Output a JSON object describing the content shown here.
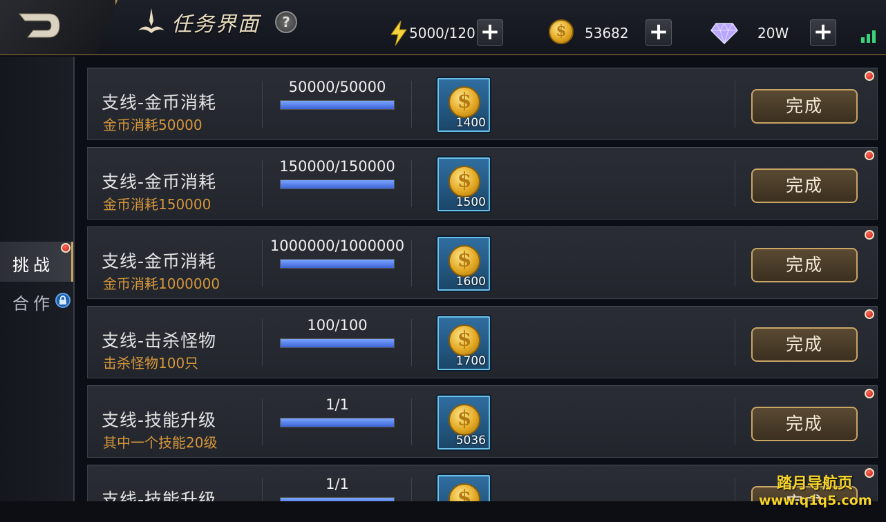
{
  "header": {
    "title": "任务界面",
    "help_label": "?",
    "energy": {
      "icon": "lightning-icon",
      "value": "5000/120"
    },
    "gold": {
      "icon": "gold-coin-icon",
      "value": "53682"
    },
    "diamond": {
      "icon": "diamond-icon",
      "value": "20W"
    },
    "plus_label": "+"
  },
  "sidebar": {
    "tabs": [
      {
        "label": "挑战",
        "active": true,
        "badge": "red-dot"
      },
      {
        "label": "合作",
        "locked": true,
        "icon": "lock-icon"
      }
    ]
  },
  "tasks": [
    {
      "name": "支线-金币消耗",
      "desc": "金币消耗50000",
      "progress_text": "50000/50000",
      "progress": 1.0,
      "reward_qty": "1400",
      "button_label": "完成"
    },
    {
      "name": "支线-金币消耗",
      "desc": "金币消耗150000",
      "progress_text": "150000/150000",
      "progress": 1.0,
      "reward_qty": "1500",
      "button_label": "完成"
    },
    {
      "name": "支线-金币消耗",
      "desc": "金币消耗1000000",
      "progress_text": "1000000/1000000",
      "progress": 1.0,
      "reward_qty": "1600",
      "button_label": "完成"
    },
    {
      "name": "支线-击杀怪物",
      "desc": "击杀怪物100只",
      "progress_text": "100/100",
      "progress": 1.0,
      "reward_qty": "1700",
      "button_label": "完成"
    },
    {
      "name": "支线-技能升级",
      "desc": "其中一个技能20级",
      "progress_text": "1/1",
      "progress": 1.0,
      "reward_qty": "5036",
      "button_label": "完成"
    },
    {
      "name": "支线-技能升级",
      "desc": "",
      "progress_text": "1/1",
      "progress": 1.0,
      "reward_qty": "",
      "button_label": "完成"
    }
  ],
  "watermark": {
    "line1": "踏月导航页",
    "line2": "www.q1q5.com"
  },
  "colors": {
    "accent_gold": "#c9a566",
    "desc_orange": "#d6973b",
    "progress_blue": "#4f78e6",
    "signal_green": "#3bd27a"
  }
}
